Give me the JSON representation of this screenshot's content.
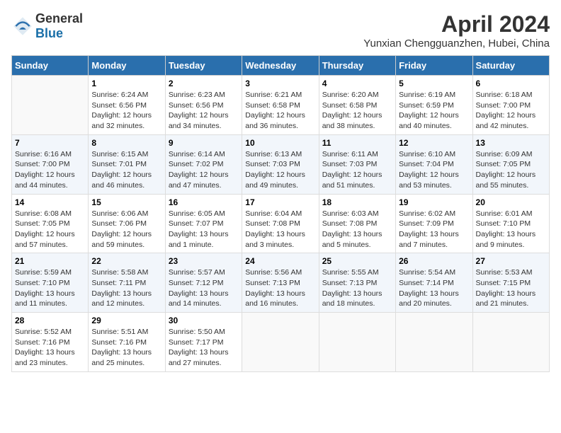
{
  "header": {
    "logo_general": "General",
    "logo_blue": "Blue",
    "month": "April 2024",
    "location": "Yunxian Chengguanzhen, Hubei, China"
  },
  "weekdays": [
    "Sunday",
    "Monday",
    "Tuesday",
    "Wednesday",
    "Thursday",
    "Friday",
    "Saturday"
  ],
  "weeks": [
    [
      {
        "day": "",
        "info": ""
      },
      {
        "day": "1",
        "info": "Sunrise: 6:24 AM\nSunset: 6:56 PM\nDaylight: 12 hours\nand 32 minutes."
      },
      {
        "day": "2",
        "info": "Sunrise: 6:23 AM\nSunset: 6:56 PM\nDaylight: 12 hours\nand 34 minutes."
      },
      {
        "day": "3",
        "info": "Sunrise: 6:21 AM\nSunset: 6:58 PM\nDaylight: 12 hours\nand 36 minutes."
      },
      {
        "day": "4",
        "info": "Sunrise: 6:20 AM\nSunset: 6:58 PM\nDaylight: 12 hours\nand 38 minutes."
      },
      {
        "day": "5",
        "info": "Sunrise: 6:19 AM\nSunset: 6:59 PM\nDaylight: 12 hours\nand 40 minutes."
      },
      {
        "day": "6",
        "info": "Sunrise: 6:18 AM\nSunset: 7:00 PM\nDaylight: 12 hours\nand 42 minutes."
      }
    ],
    [
      {
        "day": "7",
        "info": "Sunrise: 6:16 AM\nSunset: 7:00 PM\nDaylight: 12 hours\nand 44 minutes."
      },
      {
        "day": "8",
        "info": "Sunrise: 6:15 AM\nSunset: 7:01 PM\nDaylight: 12 hours\nand 46 minutes."
      },
      {
        "day": "9",
        "info": "Sunrise: 6:14 AM\nSunset: 7:02 PM\nDaylight: 12 hours\nand 47 minutes."
      },
      {
        "day": "10",
        "info": "Sunrise: 6:13 AM\nSunset: 7:03 PM\nDaylight: 12 hours\nand 49 minutes."
      },
      {
        "day": "11",
        "info": "Sunrise: 6:11 AM\nSunset: 7:03 PM\nDaylight: 12 hours\nand 51 minutes."
      },
      {
        "day": "12",
        "info": "Sunrise: 6:10 AM\nSunset: 7:04 PM\nDaylight: 12 hours\nand 53 minutes."
      },
      {
        "day": "13",
        "info": "Sunrise: 6:09 AM\nSunset: 7:05 PM\nDaylight: 12 hours\nand 55 minutes."
      }
    ],
    [
      {
        "day": "14",
        "info": "Sunrise: 6:08 AM\nSunset: 7:05 PM\nDaylight: 12 hours\nand 57 minutes."
      },
      {
        "day": "15",
        "info": "Sunrise: 6:06 AM\nSunset: 7:06 PM\nDaylight: 12 hours\nand 59 minutes."
      },
      {
        "day": "16",
        "info": "Sunrise: 6:05 AM\nSunset: 7:07 PM\nDaylight: 13 hours\nand 1 minute."
      },
      {
        "day": "17",
        "info": "Sunrise: 6:04 AM\nSunset: 7:08 PM\nDaylight: 13 hours\nand 3 minutes."
      },
      {
        "day": "18",
        "info": "Sunrise: 6:03 AM\nSunset: 7:08 PM\nDaylight: 13 hours\nand 5 minutes."
      },
      {
        "day": "19",
        "info": "Sunrise: 6:02 AM\nSunset: 7:09 PM\nDaylight: 13 hours\nand 7 minutes."
      },
      {
        "day": "20",
        "info": "Sunrise: 6:01 AM\nSunset: 7:10 PM\nDaylight: 13 hours\nand 9 minutes."
      }
    ],
    [
      {
        "day": "21",
        "info": "Sunrise: 5:59 AM\nSunset: 7:10 PM\nDaylight: 13 hours\nand 11 minutes."
      },
      {
        "day": "22",
        "info": "Sunrise: 5:58 AM\nSunset: 7:11 PM\nDaylight: 13 hours\nand 12 minutes."
      },
      {
        "day": "23",
        "info": "Sunrise: 5:57 AM\nSunset: 7:12 PM\nDaylight: 13 hours\nand 14 minutes."
      },
      {
        "day": "24",
        "info": "Sunrise: 5:56 AM\nSunset: 7:13 PM\nDaylight: 13 hours\nand 16 minutes."
      },
      {
        "day": "25",
        "info": "Sunrise: 5:55 AM\nSunset: 7:13 PM\nDaylight: 13 hours\nand 18 minutes."
      },
      {
        "day": "26",
        "info": "Sunrise: 5:54 AM\nSunset: 7:14 PM\nDaylight: 13 hours\nand 20 minutes."
      },
      {
        "day": "27",
        "info": "Sunrise: 5:53 AM\nSunset: 7:15 PM\nDaylight: 13 hours\nand 21 minutes."
      }
    ],
    [
      {
        "day": "28",
        "info": "Sunrise: 5:52 AM\nSunset: 7:16 PM\nDaylight: 13 hours\nand 23 minutes."
      },
      {
        "day": "29",
        "info": "Sunrise: 5:51 AM\nSunset: 7:16 PM\nDaylight: 13 hours\nand 25 minutes."
      },
      {
        "day": "30",
        "info": "Sunrise: 5:50 AM\nSunset: 7:17 PM\nDaylight: 13 hours\nand 27 minutes."
      },
      {
        "day": "",
        "info": ""
      },
      {
        "day": "",
        "info": ""
      },
      {
        "day": "",
        "info": ""
      },
      {
        "day": "",
        "info": ""
      }
    ]
  ]
}
